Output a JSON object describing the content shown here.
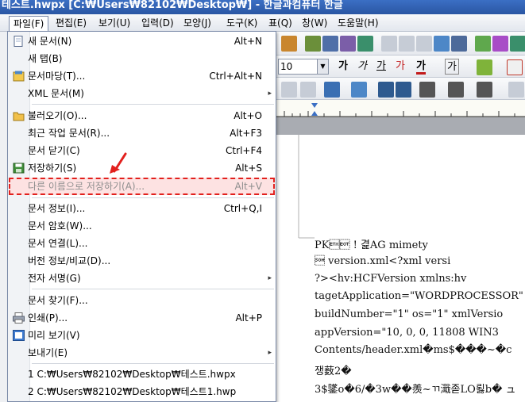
{
  "window": {
    "title": "테스트.hwpx [C:₩Users₩82102₩Desktop₩] - 한글과컴퓨터 한글"
  },
  "menubar": [
    {
      "label": "파일(F)",
      "active": true
    },
    {
      "label": "편집(E)"
    },
    {
      "label": "보기(U)"
    },
    {
      "label": "입력(D)"
    },
    {
      "label": "모양(J)"
    },
    {
      "label": "도구(K)"
    },
    {
      "label": "표(Q)"
    },
    {
      "label": "창(W)"
    },
    {
      "label": "도움말(H)"
    }
  ],
  "file_menu": {
    "items": [
      {
        "label": "새 문서(N)",
        "shortcut": "Alt+N",
        "icon": "new-document-icon"
      },
      {
        "label": "새 탭(B)"
      },
      {
        "label": "문서마당(T)...",
        "shortcut": "Ctrl+Alt+N",
        "icon": "template-icon"
      },
      {
        "label": "XML 문서(M)",
        "submenu": true
      },
      {
        "label": "불러오기(O)...",
        "shortcut": "Alt+O",
        "icon": "open-folder-icon"
      },
      {
        "label": "최근 작업 문서(R)...",
        "shortcut": "Alt+F3"
      },
      {
        "label": "문서 닫기(C)",
        "shortcut": "Ctrl+F4"
      },
      {
        "label": "저장하기(S)",
        "shortcut": "Alt+S",
        "icon": "save-icon"
      },
      {
        "label": "다른 이름으로 저장하기(A)...",
        "shortcut": "Alt+V",
        "disabled": true,
        "highlighted": true
      },
      {
        "label": "문서 정보(I)...",
        "shortcut": "Ctrl+Q,I"
      },
      {
        "label": "문서 암호(W)..."
      },
      {
        "label": "문서 연결(L)..."
      },
      {
        "label": "버전 정보/비교(D)..."
      },
      {
        "label": "전자 서명(G)",
        "submenu": true
      },
      {
        "label": "문서 찾기(F)..."
      },
      {
        "label": "인쇄(P)...",
        "shortcut": "Alt+P",
        "icon": "print-icon"
      },
      {
        "label": "미리 보기(V)",
        "icon": "preview-icon"
      },
      {
        "label": "보내기(E)",
        "submenu": true
      },
      {
        "label": "1 C:₩Users₩82102₩Desktop₩테스트.hwpx"
      },
      {
        "label": "2 C:₩Users₩82102₩Desktop₩테스트1.hwp"
      }
    ]
  },
  "toolbar": {
    "font_size": "10",
    "char_buttons": [
      "가",
      "가",
      "가",
      "가",
      "가",
      "가"
    ]
  },
  "document": {
    "lines": [
      "PK\u0003\u0004          !  겵AG               mimety",
      "\u0001               version.xml<?xml   versi",
      "?><hv:HCFVersion                  xmlns:hv",
      "tagetApplication=\"WORDPROCESSOR\"",
      "buildNumber=\"1\"   os=\"1\"   xmlVersio",
      "appVersion=\"10, 0, 0, 11808 WIN3",
      "Contents/header.xml�ms$���~�c",
      "쟁薮2�",
      "3$鐆o�6/�3w��羨~ㄲ濈졷LO뢿b�  ュ"
    ]
  },
  "colors": {
    "titlebar": "#2a56a3",
    "highlight_outline": "#e2201d",
    "annotation_arrow": "#e2201d"
  }
}
